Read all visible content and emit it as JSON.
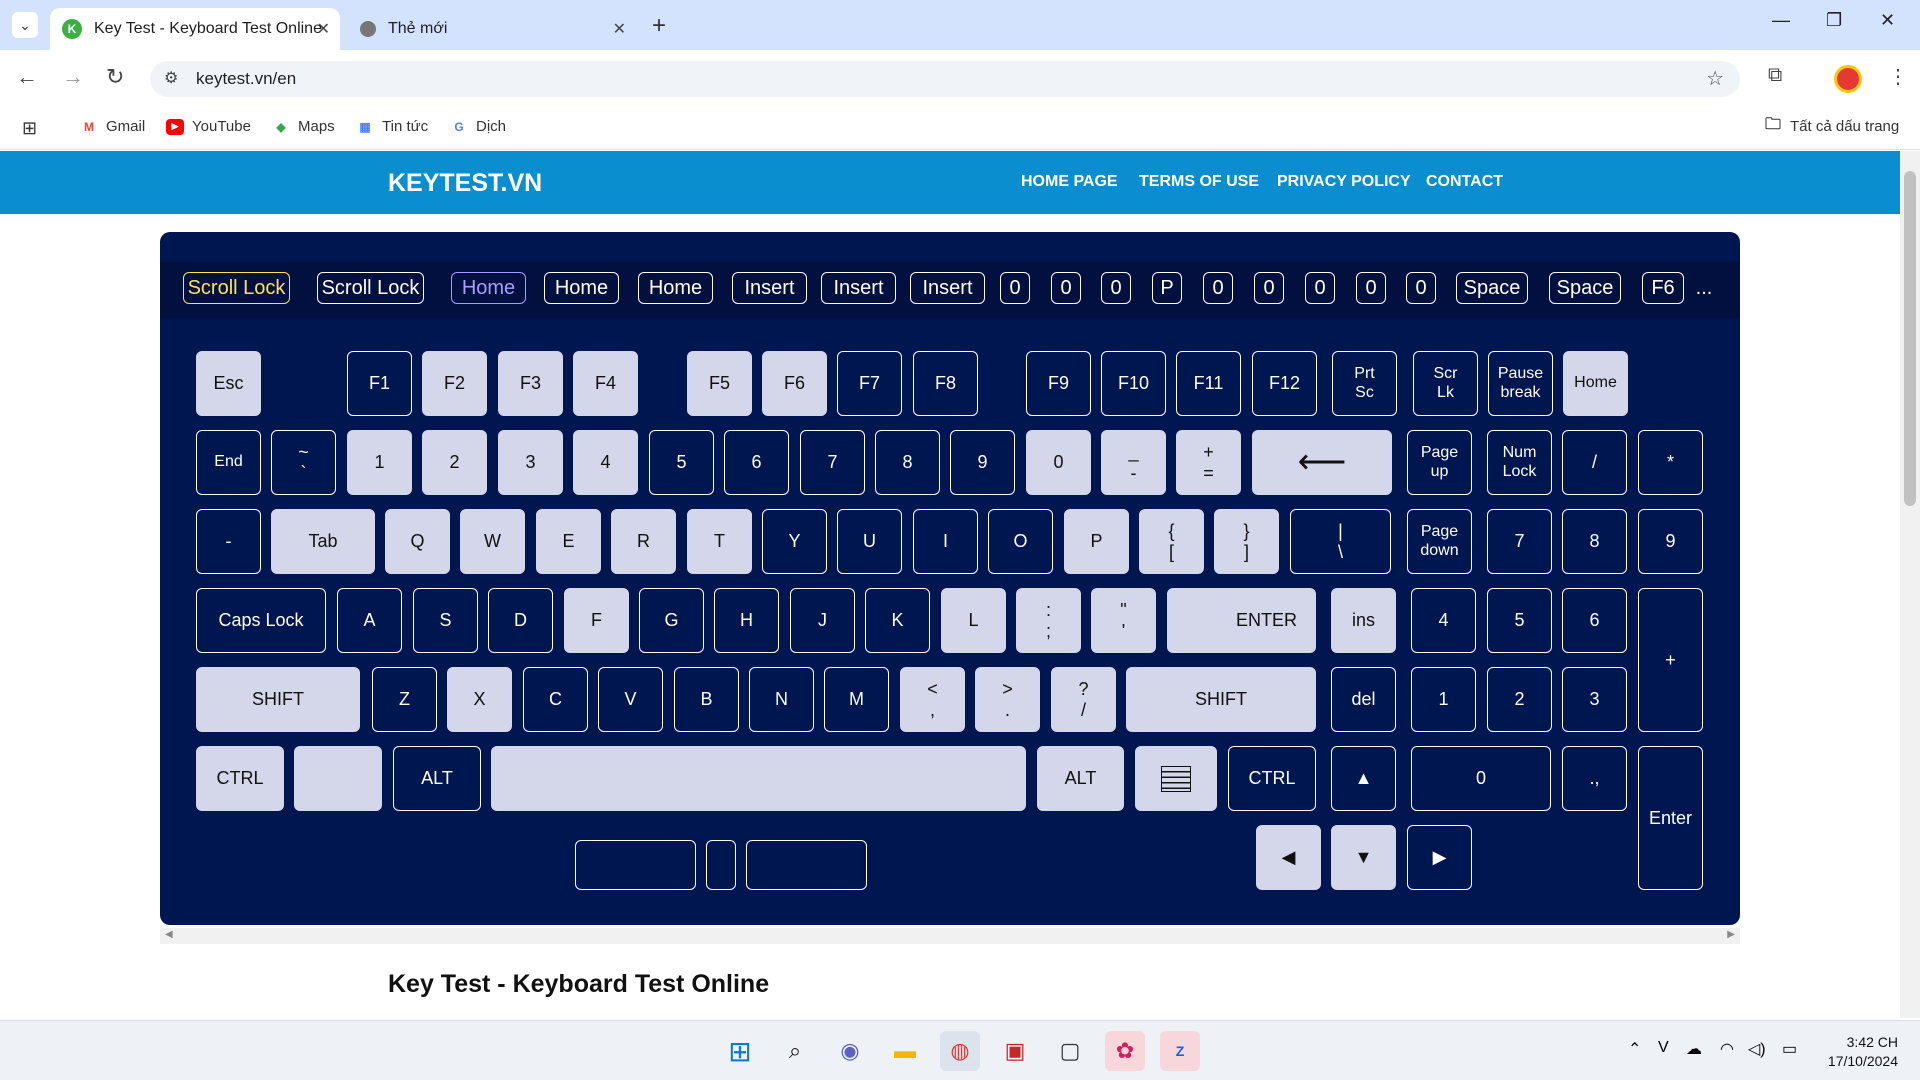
{
  "browser": {
    "tabs": [
      {
        "title": "Key Test - Keyboard Test Online",
        "favicon": "keytest-icon"
      },
      {
        "title": "Thẻ mới",
        "favicon": "chrome-icon"
      }
    ],
    "url": "keytest.vn/en",
    "bookmarks": [
      "Gmail",
      "YouTube",
      "Maps",
      "Tin tức",
      "Dịch"
    ],
    "all_bookmarks": "Tất cả dấu trang"
  },
  "site": {
    "brand": "KEYTEST.VN",
    "nav": [
      "HOME PAGE",
      "TERMS OF USE",
      "PRIVACY POLICY",
      "CONTACT"
    ],
    "heading": "Key Test - Keyboard Test Online"
  },
  "history": [
    "Scroll Lock",
    "Scroll Lock",
    "Home",
    "Home",
    "Home",
    "Insert",
    "Insert",
    "Insert",
    "0",
    "0",
    "0",
    "P",
    "0",
    "0",
    "0",
    "0",
    "0",
    "Space",
    "Space",
    "F6",
    "..."
  ],
  "keys": {
    "esc": "Esc",
    "f1": "F1",
    "f2": "F2",
    "f3": "F3",
    "f4": "F4",
    "f5": "F5",
    "f6": "F6",
    "f7": "F7",
    "f8": "F8",
    "f9": "F9",
    "f10": "F10",
    "f11": "F11",
    "f12": "F12",
    "prtsc1": "Prt",
    "prtsc2": "Sc",
    "scrlk1": "Scr",
    "scrlk2": "Lk",
    "pause1": "Pause",
    "pause2": "break",
    "home": "Home",
    "end": "End",
    "tilde1": "~",
    "tilde2": "`",
    "n1": "1",
    "n2": "2",
    "n3": "3",
    "n4": "4",
    "n5": "5",
    "n6": "6",
    "n7": "7",
    "n8": "8",
    "n9": "9",
    "n0": "0",
    "minus1": "_",
    "minus2": "-",
    "plus1": "+",
    "plus2": "=",
    "backspace": "⟵",
    "pgup1": "Page",
    "pgup2": "up",
    "numlock1": "Num",
    "numlock2": "Lock",
    "kpdiv": "/",
    "kpmul": "*",
    "kpminus": "-",
    "tab": "Tab",
    "q": "Q",
    "w": "W",
    "e": "E",
    "r": "R",
    "t": "T",
    "y": "Y",
    "u": "U",
    "i": "I",
    "o": "O",
    "p": "P",
    "lbr1": "{",
    "lbr2": "[",
    "rbr1": "}",
    "rbr2": "]",
    "bsl1": "|",
    "bsl2": "\\",
    "pgdn1": "Page",
    "pgdn2": "down",
    "kp7": "7",
    "kp8": "8",
    "kp9": "9",
    "caps": "Caps Lock",
    "a": "A",
    "s": "S",
    "d": "D",
    "f": "F",
    "g": "G",
    "h": "H",
    "j": "J",
    "k": "K",
    "l": "L",
    "semi1": ":",
    "semi2": ";",
    "quote1": "\"",
    "quote2": "'",
    "enter": "ENTER",
    "ins": "ins",
    "kp4": "4",
    "kp5": "5",
    "kp6": "6",
    "kpplus": "+",
    "lshift": "SHIFT",
    "z": "Z",
    "x": "X",
    "c": "C",
    "v": "V",
    "b": "B",
    "n": "N",
    "m": "M",
    "comma1": "<",
    "comma2": ",",
    "period1": ">",
    "period2": ".",
    "slash1": "?",
    "slash2": "/",
    "rshift": "SHIFT",
    "del": "del",
    "kp1": "1",
    "kp2": "2",
    "kp3": "3",
    "lctrl": "CTRL",
    "lalt": "ALT",
    "ralt": "ALT",
    "rctrl": "CTRL",
    "up": "▲",
    "kp0": "0",
    "kpdot": ".,",
    "kpenter": "Enter",
    "left": "◀",
    "down": "▼",
    "right": "▶"
  },
  "taskbar": {
    "time": "3:42 CH",
    "date": "17/10/2024"
  },
  "colors": {
    "header": "#0a8ecf",
    "keyboard_bg": "#001650",
    "pressed_key": "#d4d6ea",
    "tab_bar": "#d3e3fd"
  }
}
